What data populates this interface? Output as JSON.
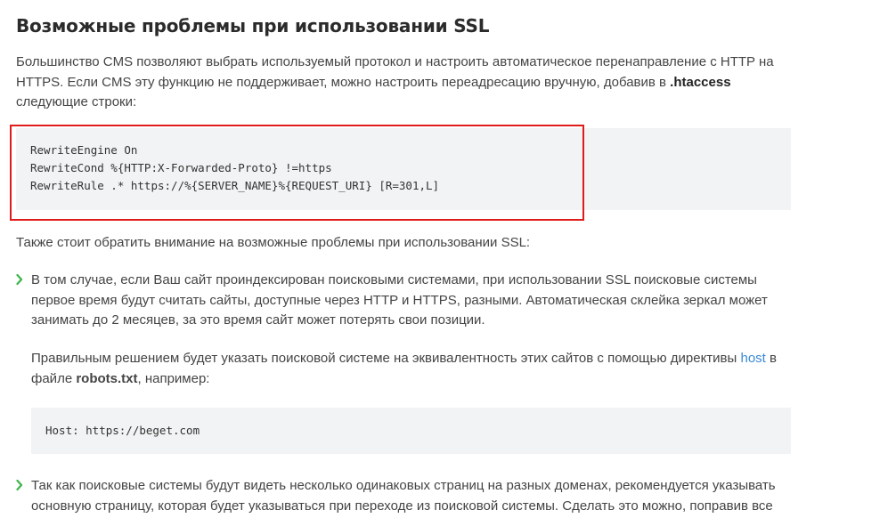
{
  "heading": "Возможные проблемы при использовании SSL",
  "intro": {
    "text_before": "Большинство CMS позволяют выбрать используемый протокол и настроить автоматическое перенаправление с HTTP на HTTPS. Если CMS эту функцию не поддерживает, можно настроить переадресацию вручную, добавив в ",
    "bold": ".htaccess",
    "text_after": " следующие строки:"
  },
  "code_block_1": {
    "lines": [
      "RewriteEngine On",
      "RewriteCond %{HTTP:X-Forwarded-Proto} !=https",
      "RewriteRule .* https://%{SERVER_NAME}%{REQUEST_URI} [R=301,L]"
    ]
  },
  "highlight_color": "#e01b1b",
  "also_note": "Также стоит обратить внимание на возможные проблемы при использовании SSL:",
  "list": [
    {
      "icon": "chevron-right-icon",
      "text": "В том случае, если Ваш сайт проиндексирован поисковыми системами, при использовании SSL поисковые системы первое время будут считать сайты, доступные через HTTP и HTTPS, разными. Автоматическая склейка зеркал может занимать до 2 месяцев, за это время сайт может потерять свои позиции.",
      "followup_before": "Правильным решением будет указать поисковой системе на эквивалентность этих сайтов с помощью директивы ",
      "followup_link": "host",
      "followup_mid": " в файле ",
      "followup_bold": "robots.txt",
      "followup_after": ", например:",
      "code": "Host: https://beget.com"
    },
    {
      "icon": "chevron-right-icon",
      "text": "Так как поисковые системы будут видеть несколько одинаковых страниц на разных доменах, рекомендуется указывать основную страницу, которая будет указываться при переходе из поисковой системы. Сделать это можно, поправив все"
    }
  ],
  "colors": {
    "accent_green": "#3db54a",
    "link": "#3a8ad6",
    "code_bg": "#f1f3f4"
  }
}
